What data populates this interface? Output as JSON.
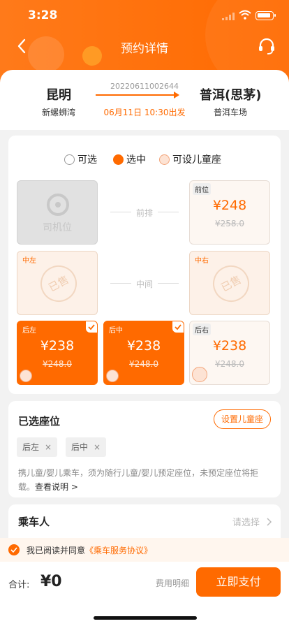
{
  "status": {
    "time": "3:28"
  },
  "nav": {
    "title": "预约详情"
  },
  "route": {
    "order_no": "20220611002644",
    "from_city": "昆明",
    "from_station": "新螺蛳湾",
    "date": "06月11日 10:30出发",
    "to_city": "普洱(思茅)",
    "to_station": "普洱车场"
  },
  "legend": {
    "available": "可选",
    "selected": "选中",
    "child_seat": "可设儿童座"
  },
  "seats": {
    "driver_label": "司机位",
    "front_row_label": "前排",
    "middle_row_label": "中间",
    "front": {
      "tag": "前位",
      "price": "¥248",
      "old_price": "¥258.0"
    },
    "mid_left": {
      "tag": "中左",
      "stamp": "已售"
    },
    "mid_right": {
      "tag": "中右",
      "stamp": "已售"
    },
    "back_left": {
      "tag": "后左",
      "price": "¥238",
      "old_price": "¥248.0"
    },
    "back_mid": {
      "tag": "后中",
      "price": "¥238",
      "old_price": "¥248.0"
    },
    "back_right": {
      "tag": "后右",
      "price": "¥238",
      "old_price": "¥248.0"
    }
  },
  "selected": {
    "title": "已选座位",
    "child_button": "设置儿童座",
    "chips": [
      "后左",
      "后中"
    ],
    "remove_symbol": "×",
    "note": "携儿童/婴儿乘车，须为随行儿童/婴儿预定座位，未预定座位将拒载。",
    "note_link": "查看说明 >"
  },
  "passenger": {
    "title": "乘车人",
    "placeholder": "请选择"
  },
  "agreement": {
    "text": "我已阅读并同意",
    "link": "《乘车服务协议》"
  },
  "bottom": {
    "total_label": "合计:",
    "total": "¥0",
    "detail": "费用明细",
    "pay": "立即支付"
  },
  "colors": {
    "accent": "#ff6a00"
  }
}
